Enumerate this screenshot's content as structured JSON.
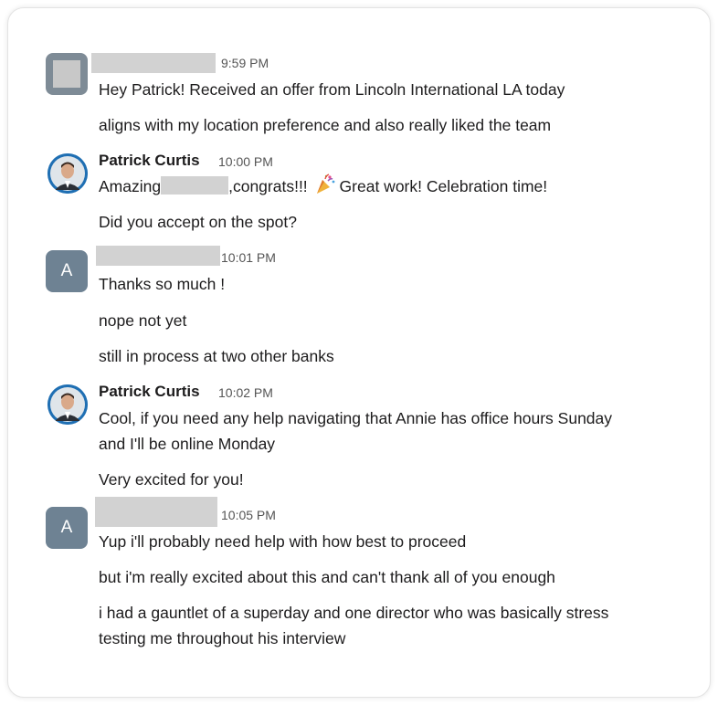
{
  "messages": [
    {
      "author": "",
      "time": "9:59 PM",
      "lines": [
        "Hey Patrick! Received an offer from Lincoln International LA today",
        "aligns with my location preference and also really liked the team"
      ]
    },
    {
      "author": "Patrick Curtis",
      "time": "10:00 PM",
      "lines_parts": {
        "before": "Amazing",
        "after": ",congrats!!!",
        "emoji": "party-popper-icon",
        "tail": "Great work! Celebration time!"
      },
      "lines": [
        "Did you accept on the spot?"
      ]
    },
    {
      "author": "",
      "avatar_letter": "A",
      "time": "10:01 PM",
      "lines": [
        "Thanks so much !",
        "nope not yet",
        "still in process at two other banks"
      ]
    },
    {
      "author": "Patrick Curtis",
      "time": "10:02 PM",
      "lines": [
        "Cool, if you need any help navigating that Annie has office hours Sunday",
        "and I'll be online Monday",
        "Very excited for you!"
      ]
    },
    {
      "author": "",
      "avatar_letter": "A",
      "time": "10:05 PM",
      "lines": [
        "Yup i'll probably need help with how best to proceed",
        "but i'm really excited about this and can't thank all of you enough",
        "i had a gauntlet of a superday and one director who was basically stress",
        "testing me throughout his interview"
      ]
    }
  ],
  "colors": {
    "avatar_letter_bg": "#6e8293",
    "redaction": "#d2d2d2",
    "photo_ring": "#1f6fb3"
  }
}
